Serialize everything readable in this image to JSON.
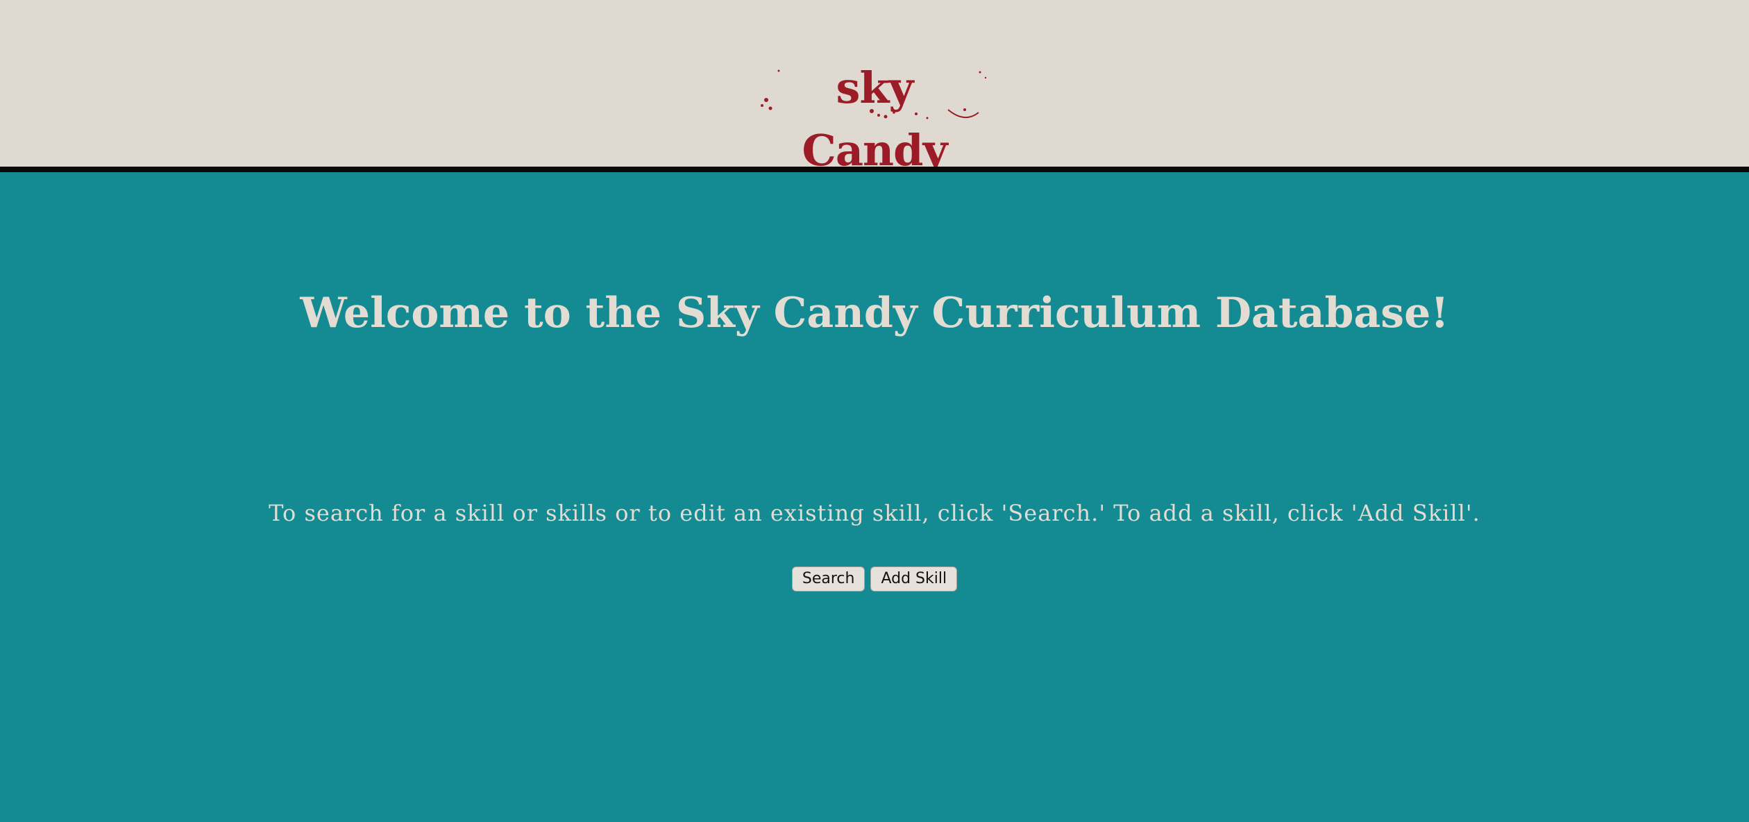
{
  "header": {
    "logo_text": "sky Candy",
    "brand_color": "#9b1c26",
    "background_color": "#e0d9d1"
  },
  "main": {
    "background_color": "#148a93",
    "text_color": "#e2dcd3",
    "heading": "Welcome to the Sky Candy Curriculum Database!",
    "instructions": "To search for a skill or skills or to edit an existing skill, click 'Search.' To add a skill, click 'Add Skill'."
  },
  "actions": {
    "search_label": "Search",
    "add_skill_label": "Add Skill"
  }
}
